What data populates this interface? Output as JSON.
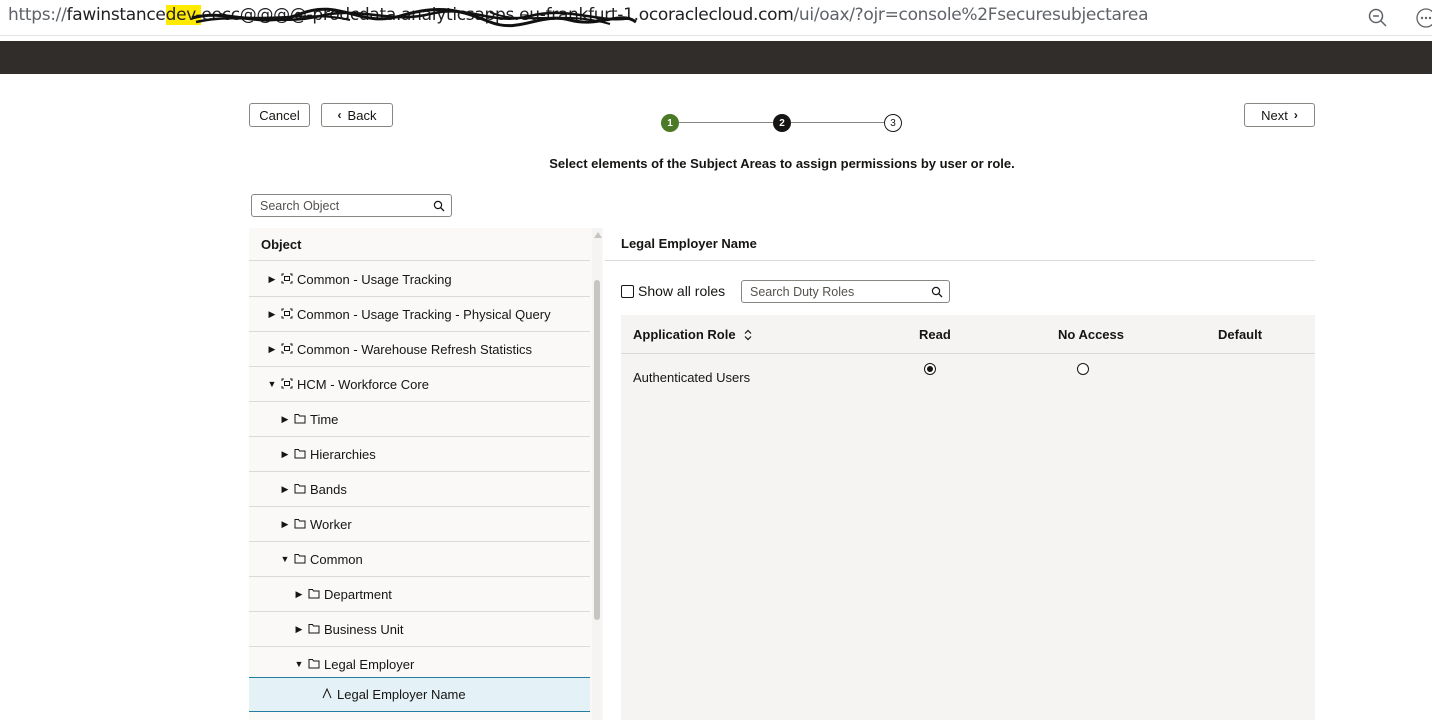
{
  "browser": {
    "url_prefix": "https://",
    "url_host_a": "fawinstance",
    "url_host_hl": "dev-",
    "url_host_b": "eecc@@@@-prodcdata.analyticsapps.eu-frankfurt-1.oc",
    "url_host_c": "oraclecloud.com",
    "url_path": "/ui/oax/?ojr=console%2Fsecuresubjectarea",
    "zoom_icon": "zoom-out-icon",
    "more_icon": "more-horizontal-icon"
  },
  "toolbar": {
    "cancel_label": "Cancel",
    "back_label": "Back",
    "next_label": "Next"
  },
  "train": {
    "steps": [
      "1",
      "2",
      "3"
    ],
    "current": 2,
    "colors": {
      "completed": "#4b7a26",
      "current": "#161513"
    }
  },
  "instructions": "Select elements of the Subject Areas to assign permissions by user or role.",
  "object_search": {
    "placeholder": "Search Object"
  },
  "tree": {
    "header": "Object",
    "rows": [
      {
        "label": "Common - Usage Tracking",
        "icon": "subject-area-icon",
        "expanded": false
      },
      {
        "label": "Common - Usage Tracking - Physical Query",
        "icon": "subject-area-icon",
        "expanded": false
      },
      {
        "label": "Common - Warehouse Refresh Statistics",
        "icon": "subject-area-icon",
        "expanded": false
      },
      {
        "label": "HCM - Workforce Core",
        "icon": "subject-area-icon",
        "expanded": true
      },
      {
        "label": "Time",
        "icon": "folder-icon",
        "expanded": false
      },
      {
        "label": "Hierarchies",
        "icon": "folder-icon",
        "expanded": false
      },
      {
        "label": "Bands",
        "icon": "folder-icon",
        "expanded": false
      },
      {
        "label": "Worker",
        "icon": "folder-icon",
        "expanded": false
      },
      {
        "label": "Common",
        "icon": "folder-icon",
        "expanded": true
      },
      {
        "label": "Department",
        "icon": "folder-icon",
        "expanded": false
      },
      {
        "label": "Business Unit",
        "icon": "folder-icon",
        "expanded": false
      },
      {
        "label": "Legal Employer",
        "icon": "folder-icon",
        "expanded": true
      },
      {
        "label": "Legal Employer Name",
        "icon": "attribute-icon",
        "selected": true
      }
    ]
  },
  "permissions": {
    "title": "Legal Employer Name",
    "show_all_label": "Show all roles",
    "show_all_checked": false,
    "duty_search_placeholder": "Search Duty Roles",
    "columns": {
      "role": "Application Role",
      "read": "Read",
      "no_access": "No Access",
      "default": "Default"
    },
    "rows": [
      {
        "role": "Authenticated Users",
        "selected": "read"
      }
    ]
  }
}
